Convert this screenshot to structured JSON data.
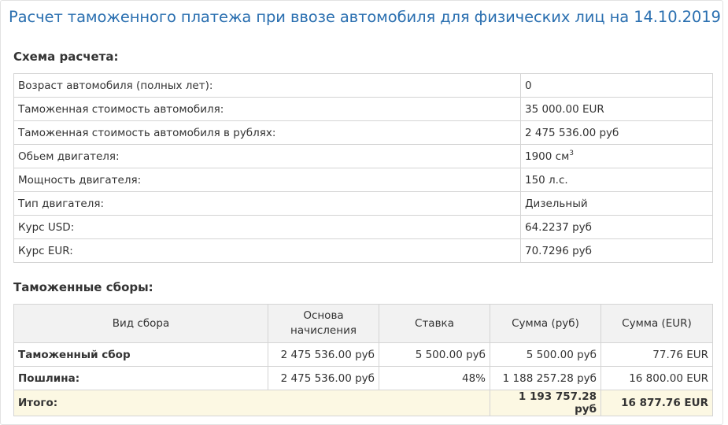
{
  "page_title": "Расчет таможенного платежа при ввозе автомобиля для физических лиц на 14.10.2019",
  "scheme": {
    "title": "Схема расчета:",
    "rows": [
      {
        "label": "Возраст автомобиля (полных лет):",
        "value": "0"
      },
      {
        "label": "Таможенная стоимость автомобиля:",
        "value": "35 000.00 EUR"
      },
      {
        "label": "Таможенная стоимость автомобиля в рублях:",
        "value": "2 475 536.00 руб"
      },
      {
        "label": "Обьем двигателя:",
        "value": "1900 см",
        "sup": "3"
      },
      {
        "label": "Мощность двигателя:",
        "value": "150 л.с."
      },
      {
        "label": "Тип двигателя:",
        "value": "Дизельный"
      },
      {
        "label": "Курс USD:",
        "value": "64.2237 руб"
      },
      {
        "label": "Курс EUR:",
        "value": "70.7296 руб"
      }
    ]
  },
  "fees": {
    "title": "Таможенные сборы:",
    "headers": [
      "Вид сбора",
      "Основа начисления",
      "Ставка",
      "Сумма (руб)",
      "Сумма (EUR)"
    ],
    "rows": [
      {
        "type": "Таможенный сбор",
        "base": "2 475 536.00 руб",
        "rate": "5 500.00 руб",
        "rub": "5 500.00 руб",
        "eur": "77.76 EUR"
      },
      {
        "type": "Пошлина:",
        "base": "2 475 536.00 руб",
        "rate": "48%",
        "rub": "1 188 257.28 руб",
        "eur": "16 800.00 EUR"
      }
    ],
    "total": {
      "label": "Итого:",
      "rub": "1 193 757.28 руб",
      "eur": "16 877.76 EUR"
    }
  }
}
